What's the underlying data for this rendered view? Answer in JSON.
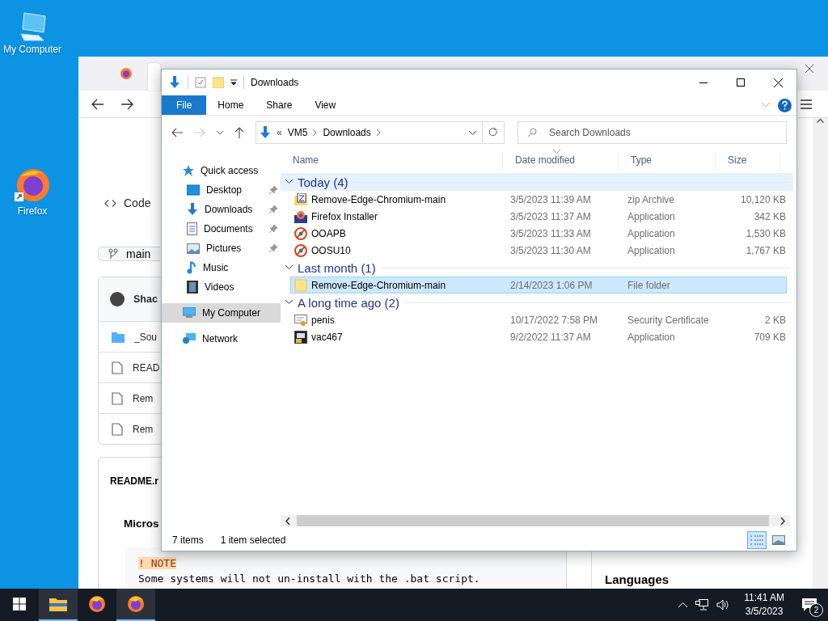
{
  "desktop_icons": [
    {
      "label": "My Computer",
      "kind": "computer"
    },
    {
      "label": "Firefox",
      "kind": "firefox"
    }
  ],
  "browser": {
    "code_tab": "Code",
    "branch": "main",
    "repo_name": "Shac",
    "files": [
      {
        "name": "_Sou",
        "kind": "folder"
      },
      {
        "name": "READ",
        "kind": "file"
      },
      {
        "name": "Rem",
        "kind": "file"
      },
      {
        "name": "Rem",
        "kind": "file"
      }
    ],
    "readme_title": "README.r",
    "heading": "Micros",
    "note_label": "! NOTE",
    "note_text": "Some systems will not un-install with the .bat script.",
    "sidebar_heading": "Languages"
  },
  "explorer": {
    "title": "Downloads",
    "ribbon_tabs": [
      {
        "label": "File",
        "selected": true
      },
      {
        "label": "Home",
        "selected": false
      },
      {
        "label": "Share",
        "selected": false
      },
      {
        "label": "View",
        "selected": false
      }
    ],
    "address": {
      "overflow": "«",
      "parts": [
        "VM5",
        "Downloads"
      ]
    },
    "search": {
      "placeholder": "Search Downloads"
    },
    "nav": [
      {
        "label": "Quick access",
        "kind": "star",
        "selected": false,
        "children": [
          {
            "label": "Desktop",
            "kind": "desktop",
            "pinned": true,
            "selected": false
          },
          {
            "label": "Downloads",
            "kind": "download",
            "pinned": true,
            "selected": false
          },
          {
            "label": "Documents",
            "kind": "document",
            "pinned": true,
            "selected": false
          },
          {
            "label": "Pictures",
            "kind": "picture",
            "pinned": true,
            "selected": false
          },
          {
            "label": "Music",
            "kind": "music",
            "pinned": false,
            "selected": false
          },
          {
            "label": "Videos",
            "kind": "video",
            "pinned": false,
            "selected": false
          }
        ]
      },
      {
        "label": "My Computer",
        "kind": "computer",
        "selected": true
      },
      {
        "label": "Network",
        "kind": "network",
        "selected": false
      }
    ],
    "columns": [
      "Name",
      "Date modified",
      "Type",
      "Size"
    ],
    "groups": [
      {
        "label": "Today (4)",
        "files": [
          {
            "name": "Remove-Edge-Chromium-main",
            "date": "3/5/2023 11:39 AM",
            "type": "zip Archive",
            "size": "10,120 KB",
            "kind": "zip",
            "selected": false
          },
          {
            "name": "Firefox Installer",
            "date": "3/5/2023 11:37 AM",
            "type": "Application",
            "size": "342 KB",
            "kind": "installer",
            "selected": false
          },
          {
            "name": "OOAPB",
            "date": "3/5/2023 11:33 AM",
            "type": "Application",
            "size": "1,530 KB",
            "kind": "app",
            "selected": false
          },
          {
            "name": "OOSU10",
            "date": "3/5/2023 11:30 AM",
            "type": "Application",
            "size": "1,767 KB",
            "kind": "app",
            "selected": false
          }
        ]
      },
      {
        "label": "Last month (1)",
        "files": [
          {
            "name": "Remove-Edge-Chromium-main",
            "date": "2/14/2023 1:06 PM",
            "type": "File folder",
            "kind": "folder",
            "selected": true
          }
        ]
      },
      {
        "label": "A long time ago (2)",
        "files": [
          {
            "name": "penis",
            "date": "10/17/2022 7:58 PM",
            "type": "Security Certificate",
            "size": "2 KB",
            "kind": "certificate",
            "selected": false
          },
          {
            "name": "vac467",
            "date": "9/2/2022 11:37 AM",
            "type": "Application",
            "size": "709 KB",
            "kind": "program",
            "selected": false
          }
        ]
      }
    ],
    "status": {
      "count": "7 items",
      "selection": "1 item selected"
    },
    "views": [
      {
        "kind": "details",
        "selected": true
      },
      {
        "kind": "thumbnails",
        "selected": false
      }
    ]
  },
  "taskbar": {
    "apps": [
      {
        "kind": "explorer",
        "active": true
      },
      {
        "kind": "firefox",
        "active": false
      },
      {
        "kind": "firefox",
        "active": true
      }
    ],
    "time": "11:41 AM",
    "date": "3/5/2023",
    "notifications": "2"
  }
}
